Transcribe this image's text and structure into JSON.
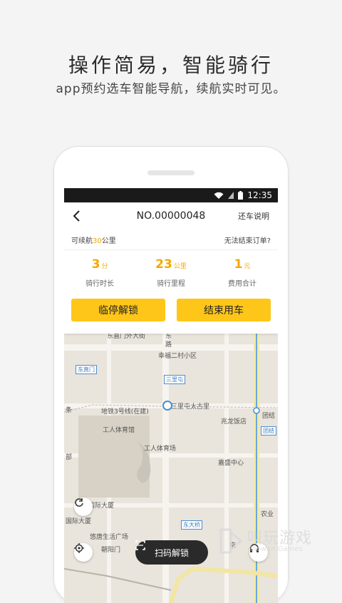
{
  "hero": {
    "title": "操作简易，智能骑行",
    "subtitle": "app预约选车智能导航，续航实时可见。"
  },
  "statusbar": {
    "time": "12:35"
  },
  "navbar": {
    "title": "NO.00000048",
    "help": "还车说明"
  },
  "range": {
    "prefix": "可续航",
    "value": "30",
    "unit": "公里",
    "cant_end": "无法结束订单?"
  },
  "stats": [
    {
      "value": "3",
      "unit": "分",
      "label": "骑行时长"
    },
    {
      "value": "23",
      "unit": "公里",
      "label": "骑行里程"
    },
    {
      "value": "1",
      "unit": "元",
      "label": "费用合计"
    }
  ],
  "actions": {
    "pause": "临停解锁",
    "end": "结束用车"
  },
  "map": {
    "labels": {
      "street1": "东直门外大街",
      "street2": "东",
      "street3": "路",
      "community": "幸福二村小区",
      "dongzhimen": "东直门",
      "sanlitun": "三里屯",
      "taikoo": "三里屯太古里",
      "metro3": "地铁3号线(在建)",
      "zhaolong": "兆龙饭店",
      "tuanjiehu": "团结",
      "tuanjiehu2": "团结",
      "gym": "工人体育馆",
      "stadium": "工人体育场",
      "jiasheng": "嘉盛中心",
      "guoji": "国际大厦",
      "guoji2": "国际大厦",
      "dongdaqiao": "东大桥",
      "yuetang": "悠唐生活广场",
      "chaoyang": "朝阳门",
      "tiao": "条",
      "bu": "部",
      "nongzhan": "农业",
      "jing": "京"
    }
  },
  "scan_label": "扫码解锁",
  "watermark": {
    "title": "叫玩游戏",
    "sub": "Jiaowan Games"
  }
}
